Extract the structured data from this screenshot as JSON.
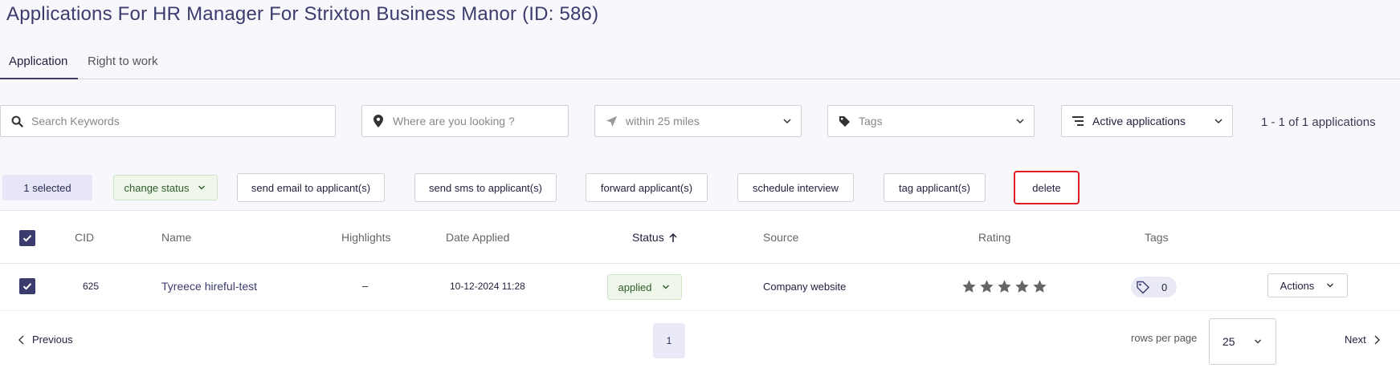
{
  "page": {
    "title": "Applications For HR Manager For Strixton Business Manor (ID: 586)"
  },
  "tabs": [
    {
      "label": "Application",
      "active": true
    },
    {
      "label": "Right to work",
      "active": false
    }
  ],
  "filters": {
    "search_placeholder": "Search Keywords",
    "location_placeholder": "Where are you looking ?",
    "radius_value": "within 25 miles",
    "tags_placeholder": "Tags",
    "application_filter_value": "Active applications",
    "results_count": "1 - 1 of 1 applications"
  },
  "bulk_actions": {
    "selected_label": "1 selected",
    "change_status": "change status",
    "send_email": "send email to applicant(s)",
    "send_sms": "send sms to applicant(s)",
    "forward": "forward applicant(s)",
    "schedule": "schedule interview",
    "tag": "tag applicant(s)",
    "delete": "delete"
  },
  "table": {
    "headers": {
      "cid": "CID",
      "name": "Name",
      "highlights": "Highlights",
      "date_applied": "Date Applied",
      "status": "Status",
      "source": "Source",
      "rating": "Rating",
      "tags": "Tags"
    },
    "rows": [
      {
        "selected": true,
        "cid": "625",
        "name": "Tyreece hireful-test",
        "highlights": "–",
        "date_applied": "10-12-2024 11:28",
        "status": "applied",
        "source": "Company website",
        "rating": 0,
        "tags_count": "0",
        "actions_label": "Actions"
      }
    ]
  },
  "pagination": {
    "previous": "Previous",
    "next": "Next",
    "current_page": "1",
    "rows_per_page_label": "rows per page",
    "rows_per_page_value": "25"
  },
  "colors": {
    "accent": "#3b3b6d",
    "status_green_bg": "#eef7ea",
    "delete_highlight": "#e01b24"
  }
}
